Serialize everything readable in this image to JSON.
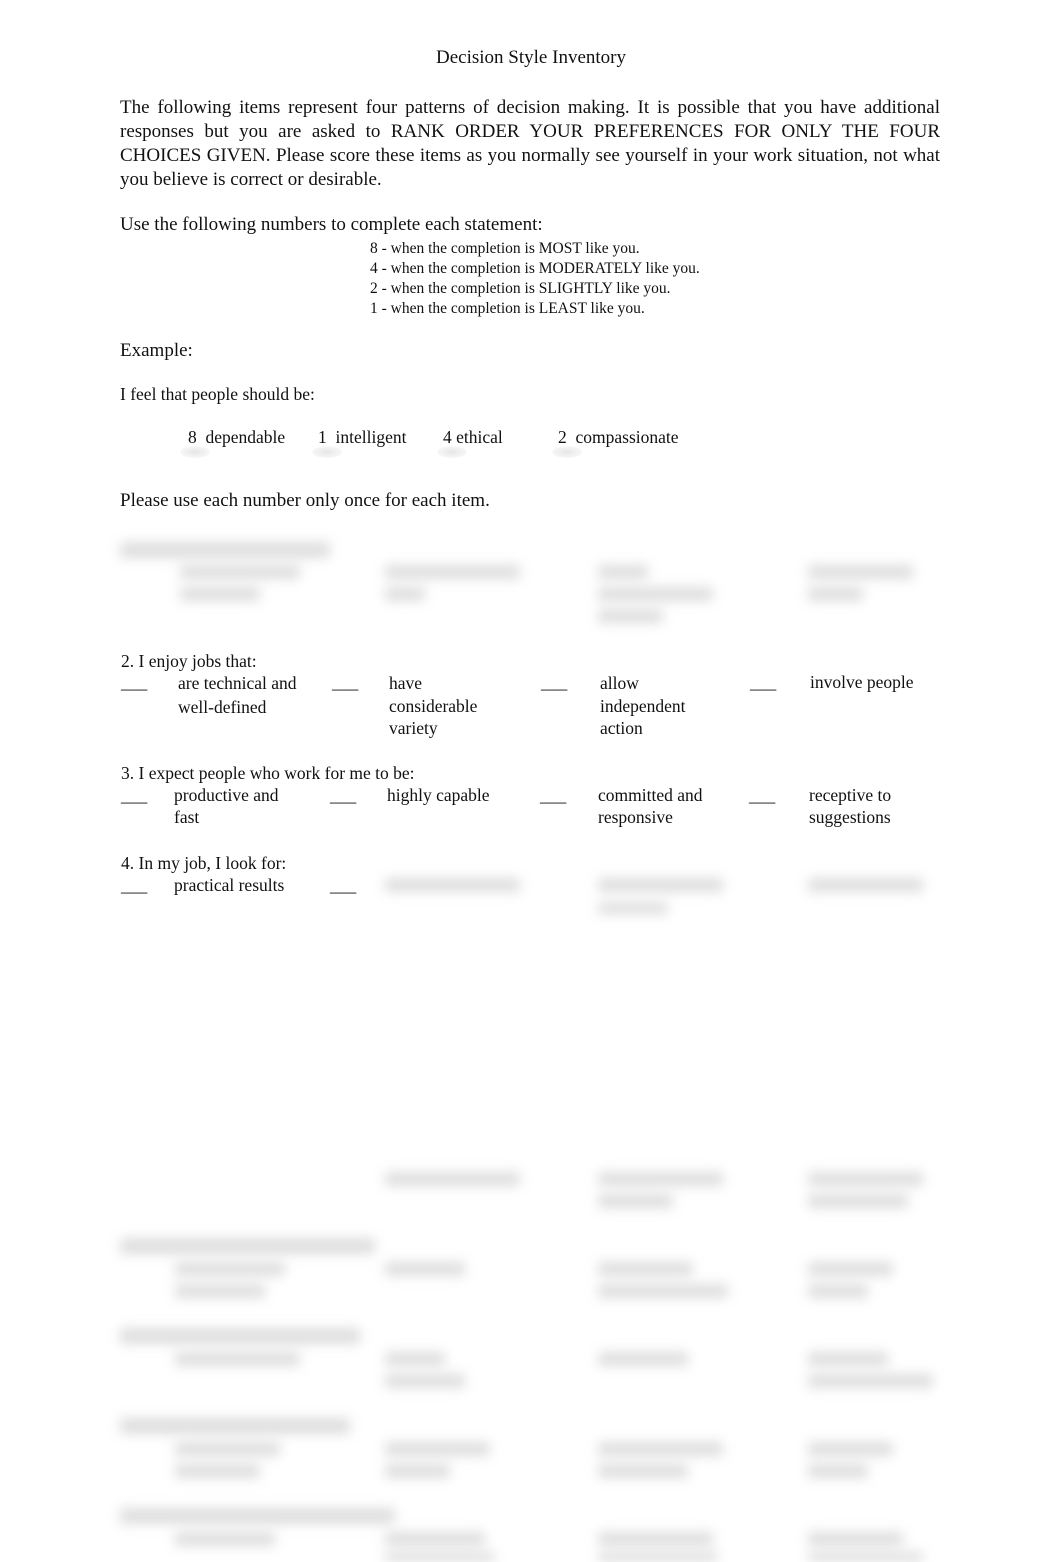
{
  "document": {
    "title": "Decision Style Inventory",
    "intro": "The following items represent four patterns of decision making. It is possible that you have additional responses but you are asked to RANK ORDER YOUR PREFERENCES FOR ONLY THE FOUR CHOICES GIVEN. Please score these items as you normally see yourself in your work situation, not what you believe is correct or desirable.",
    "scale_intro": "Use the following numbers to complete each statement:",
    "scale": [
      "8 - when the completion is MOST like you.",
      "4 - when the completion is MODERATELY like you.",
      "2 - when the completion is SLIGHTLY like you.",
      "1 - when the completion is LEAST like you."
    ],
    "example_label": "Example:",
    "example_prompt": "I feel that people should be:",
    "example_items": [
      {
        "score": "8",
        "text": "dependable"
      },
      {
        "score": "1",
        "text": "intelligent"
      },
      {
        "score": "4",
        "text": "ethical"
      },
      {
        "score": "2",
        "text": "compassionate"
      }
    ],
    "instruction": "Please use each number only once for each item.",
    "blank": "___",
    "questions": [
      {
        "prompt": "2. I enjoy jobs that:",
        "options": [
          [
            "are technical and",
            "well-defined"
          ],
          [
            "have",
            "considerable",
            "variety"
          ],
          [
            "allow",
            "independent",
            "action"
          ],
          [
            "involve people"
          ]
        ]
      },
      {
        "prompt": "3. I expect people who work for me to be:",
        "options": [
          [
            "productive and",
            "fast"
          ],
          [
            "highly capable"
          ],
          [
            "committed and",
            "responsive"
          ],
          [
            "receptive to",
            "suggestions"
          ]
        ]
      },
      {
        "prompt": "4. In my job, I look for:",
        "options": [
          [
            "practical results"
          ]
        ]
      }
    ]
  }
}
